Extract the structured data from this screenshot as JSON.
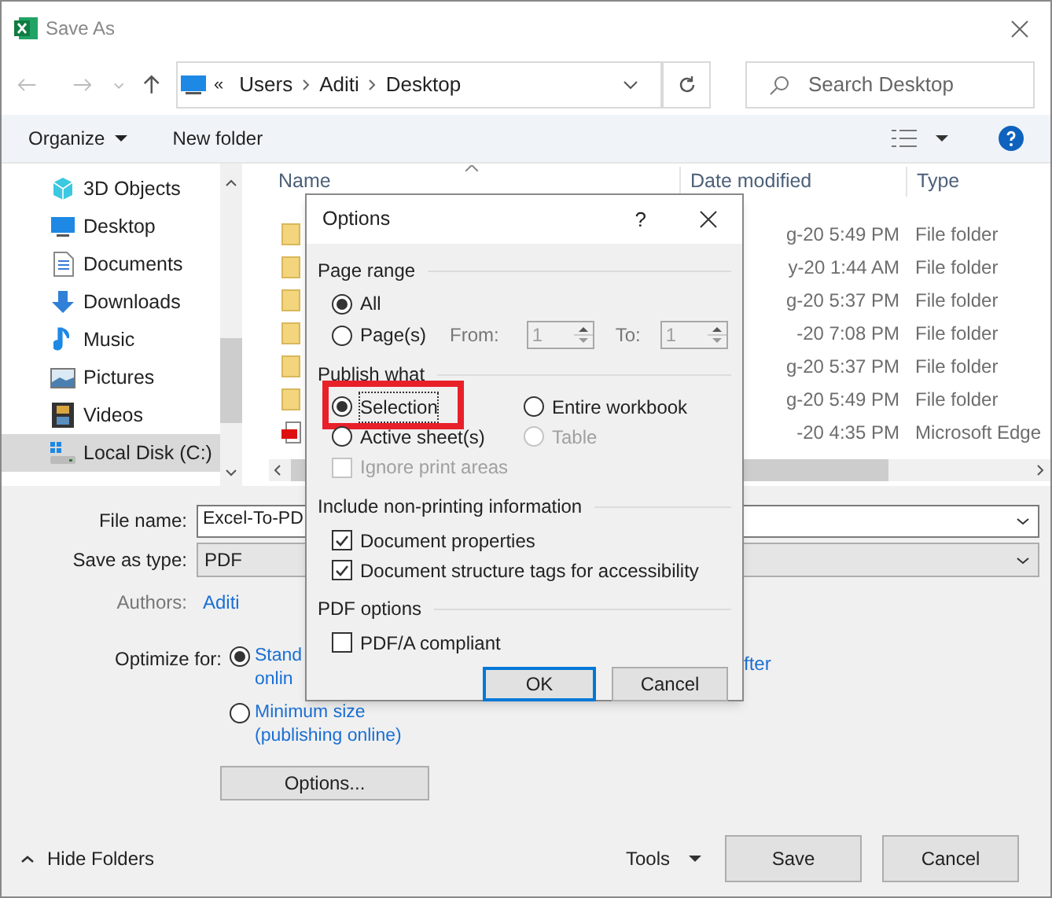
{
  "window": {
    "title": "Save As"
  },
  "address_bar": {
    "overflow": "«",
    "path": [
      "Users",
      "Aditi",
      "Desktop"
    ]
  },
  "search": {
    "placeholder": "Search Desktop"
  },
  "toolbar": {
    "organize": "Organize",
    "new_folder": "New folder"
  },
  "nav_pane": {
    "items": [
      {
        "label": "3D Objects",
        "kind": "cube",
        "selected": false
      },
      {
        "label": "Desktop",
        "kind": "desktop",
        "selected": false
      },
      {
        "label": "Documents",
        "kind": "document",
        "selected": false
      },
      {
        "label": "Downloads",
        "kind": "download",
        "selected": false
      },
      {
        "label": "Music",
        "kind": "music",
        "selected": false
      },
      {
        "label": "Pictures",
        "kind": "picture",
        "selected": false
      },
      {
        "label": "Videos",
        "kind": "video",
        "selected": false
      },
      {
        "label": "Local Disk (C:)",
        "kind": "drive",
        "selected": true
      }
    ]
  },
  "file_list": {
    "columns": [
      "Name",
      "Date modified",
      "Type"
    ],
    "rows": [
      {
        "kind": "folder",
        "date": "g-20 5:49 PM",
        "type": "File folder"
      },
      {
        "kind": "folder",
        "date": "y-20 1:44 AM",
        "type": "File folder"
      },
      {
        "kind": "folder",
        "date": "g-20 5:37 PM",
        "type": "File folder"
      },
      {
        "kind": "folder",
        "date": "-20 7:08 PM",
        "type": "File folder"
      },
      {
        "kind": "folder",
        "date": "g-20 5:37 PM",
        "type": "File folder"
      },
      {
        "kind": "folder",
        "date": "g-20 5:49 PM",
        "type": "File folder"
      },
      {
        "kind": "pdf",
        "date": "-20 4:35 PM",
        "type": "Microsoft Edge"
      }
    ]
  },
  "form": {
    "file_name_label": "File name:",
    "file_name": "Excel-To-PD",
    "save_type_label": "Save as type:",
    "save_type": "PDF",
    "authors_label": "Authors:",
    "authors": "Aditi",
    "optimize_label": "Optimize for:",
    "optimize_options": [
      {
        "lines": [
          "Stand",
          "onlin"
        ],
        "selected": true
      },
      {
        "lines": [
          "Minimum size",
          "(publishing online)"
        ],
        "selected": false
      }
    ],
    "optimize_right_part": "fter",
    "options_button": "Options..."
  },
  "footer": {
    "hide_folders": "Hide Folders",
    "tools": "Tools",
    "save": "Save",
    "cancel": "Cancel"
  },
  "options_dialog": {
    "title": "Options",
    "help": "?",
    "page_range": {
      "heading": "Page range",
      "options": [
        {
          "label": "All",
          "selected": true
        },
        {
          "label": "Page(s)",
          "selected": false
        }
      ],
      "from_label": "From:",
      "from": "1",
      "to_label": "To:",
      "to": "1"
    },
    "publish_what": {
      "heading": "Publish what",
      "options": [
        {
          "label": "Selection",
          "selected": true,
          "disabled": false,
          "highlighted": true
        },
        {
          "label": "Entire workbook",
          "selected": false,
          "disabled": false,
          "highlighted": false
        },
        {
          "label": "Active sheet(s)",
          "selected": false,
          "disabled": false,
          "highlighted": false
        },
        {
          "label": "Table",
          "selected": false,
          "disabled": true,
          "highlighted": false
        }
      ],
      "ignore_print_areas": {
        "label": "Ignore print areas",
        "checked": false,
        "disabled": true
      }
    },
    "non_printing": {
      "heading": "Include non-printing information",
      "items": [
        {
          "label": "Document properties",
          "checked": true
        },
        {
          "label": "Document structure tags for accessibility",
          "checked": true
        }
      ]
    },
    "pdf_options": {
      "heading": "PDF options",
      "items": [
        {
          "label": "PDF/A compliant",
          "checked": false
        }
      ]
    },
    "ok": "OK",
    "cancel": "Cancel"
  }
}
